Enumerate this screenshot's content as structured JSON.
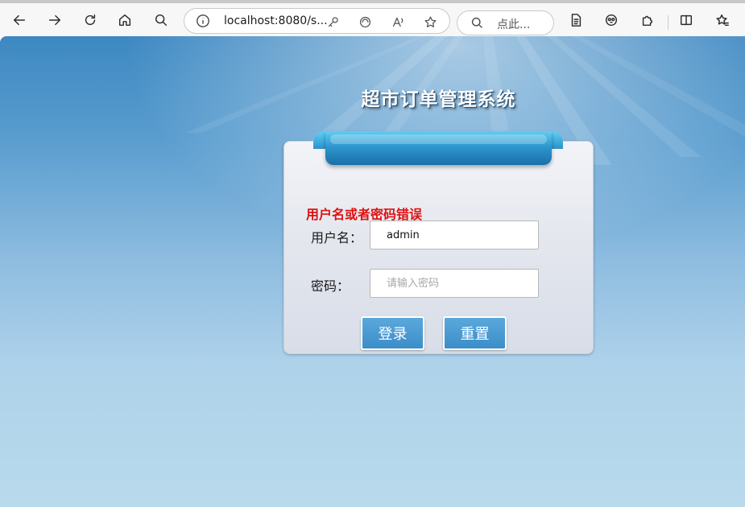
{
  "browser": {
    "url": "localhost:8080/s...",
    "search_placeholder": "点此..."
  },
  "page": {
    "system_title": "超市订单管理系统",
    "error_message": "用户名或者密码错误",
    "username_label": "用户名：",
    "username_value": "admin",
    "password_label": "密码：",
    "password_placeholder": "请输入密码",
    "login_button": "登录",
    "reset_button": "重置"
  },
  "colors": {
    "accent": "#3c8ec9",
    "error": "#e01010",
    "background_top": "#3d88c2",
    "background_bottom": "#b9daec"
  }
}
